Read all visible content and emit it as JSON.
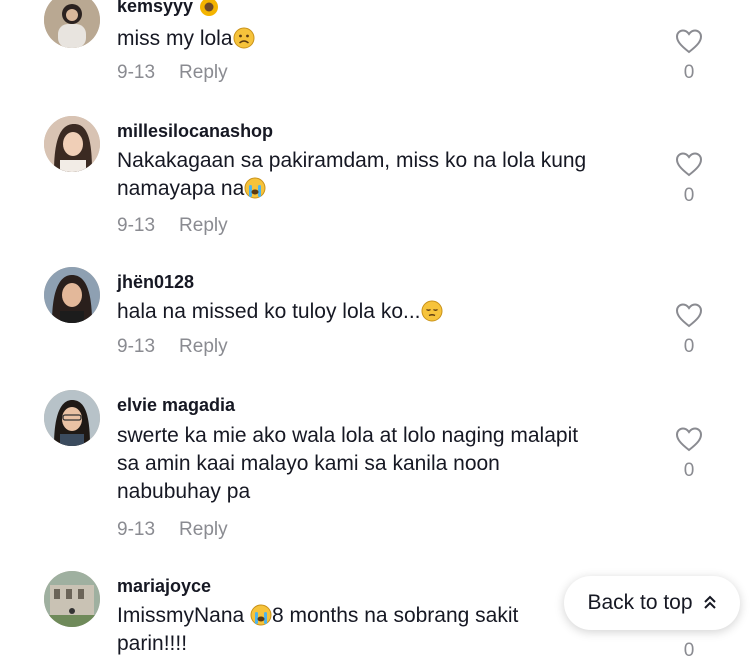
{
  "comments": [
    {
      "username": "kemsyyy",
      "username_emoji": "sunflower-emoji",
      "text": "miss my lola",
      "text_emoji": "frowning-face-emoji",
      "date": "9-13",
      "reply_label": "Reply",
      "likes": "0"
    },
    {
      "username": "millesilocanashop",
      "text": "Nakakagaan sa pakiramdam, miss ko na lola kung\nnamayapa na",
      "text_emoji": "loudly-crying-face-emoji",
      "date": "9-13",
      "reply_label": "Reply",
      "likes": "0"
    },
    {
      "username": "jhën0128",
      "text": "hala na missed ko tuloy lola ko...",
      "text_emoji": "pensive-face-emoji",
      "date": "9-13",
      "reply_label": "Reply",
      "likes": "0"
    },
    {
      "username": "elvie magadia",
      "text": "swerte ka mie ako wala lola at lolo naging malapit\nsa amin kaai malayo kami sa kanila noon\nnabubuhay pa",
      "date": "9-13",
      "reply_label": "Reply",
      "likes": "0"
    },
    {
      "username": "mariajoyce",
      "text_before": "ImissmyNana ",
      "text_emoji": "loudly-crying-face-emoji",
      "text_after": "8 months na sobrang sakit\nparin!!!!",
      "likes": "0"
    }
  ],
  "back_to_top": {
    "label": "Back to top",
    "icon": "double-chevron-up-icon"
  },
  "colors": {
    "text": "#161823",
    "muted": "#8a8b91",
    "background": "#ffffff"
  }
}
